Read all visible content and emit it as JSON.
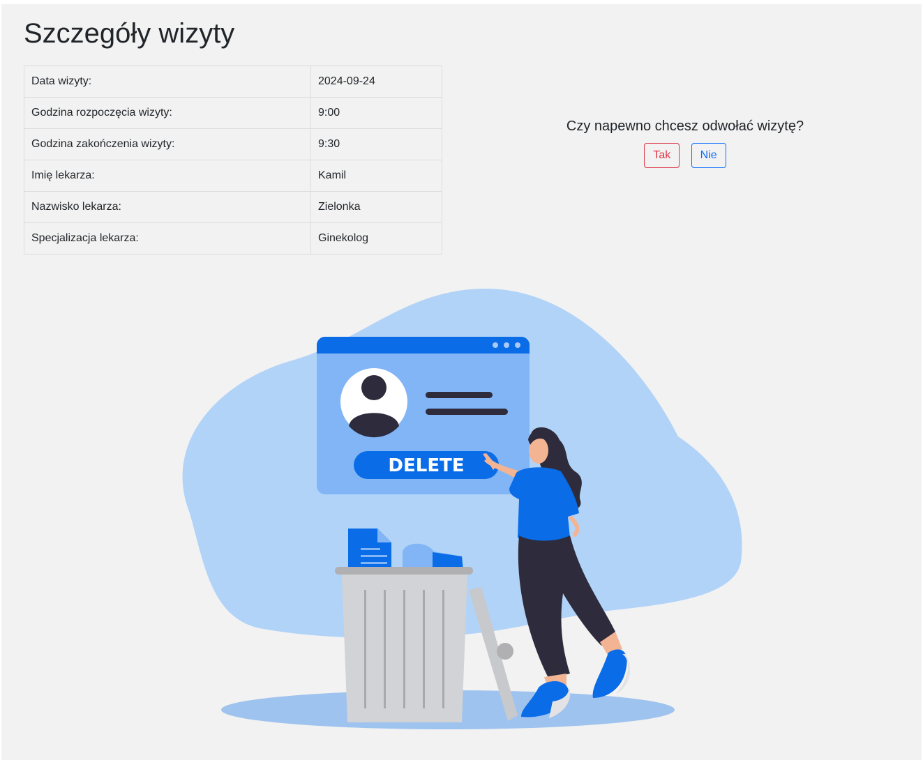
{
  "page": {
    "title": "Szczegóły wizyty"
  },
  "details": [
    {
      "label": "Data wizyty:",
      "value": "2024-09-24"
    },
    {
      "label": "Godzina rozpoczęcia wizyty:",
      "value": "9:00"
    },
    {
      "label": "Godzina zakończenia wizyty:",
      "value": "9:30"
    },
    {
      "label": "Imię lekarza:",
      "value": "Kamil"
    },
    {
      "label": "Nazwisko lekarza:",
      "value": "Zielonka"
    },
    {
      "label": "Specjalizacja lekarza:",
      "value": "Ginekolog"
    }
  ],
  "confirm": {
    "question": "Czy napewno chcesz odwołać wizytę?",
    "yes_label": "Tak",
    "no_label": "Nie"
  },
  "illustration": {
    "button_text": "DELETE"
  },
  "colors": {
    "danger": "#dc3545",
    "primary": "#0d6efd",
    "illustration_blue": "#0a6ce6",
    "blob": "#b1d3f8"
  }
}
